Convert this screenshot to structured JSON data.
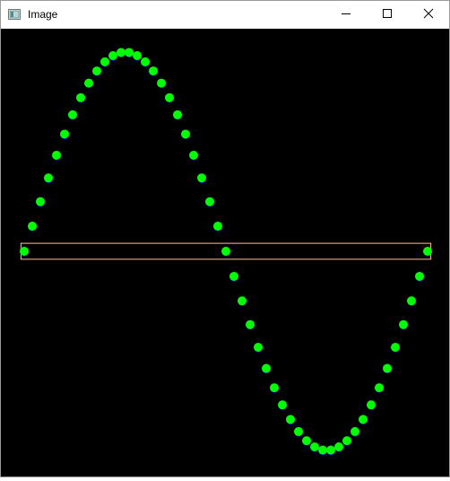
{
  "window": {
    "title": "Image",
    "app_icon": "image-window-icon",
    "controls": [
      "minimize-icon",
      "maximize-icon",
      "close-icon"
    ]
  },
  "canvas": {
    "background": "#000000",
    "point_color": "#00ff00",
    "underlay_color": "#0000ff",
    "box_color": "#ffc0a0"
  },
  "chart_data": {
    "type": "scatter",
    "title": "",
    "xlabel": "",
    "ylabel": "",
    "grid": false,
    "legend": "none",
    "xlim": [
      0,
      50
    ],
    "ylim": [
      -1,
      1
    ],
    "series": [
      {
        "x": [
          0,
          1,
          2,
          3,
          4,
          5,
          6,
          7,
          8,
          9,
          10,
          11,
          12,
          13,
          14,
          15,
          16,
          17,
          18,
          19,
          20,
          21,
          22,
          23,
          24,
          25,
          26,
          27,
          28,
          29,
          30,
          31,
          32,
          33,
          34,
          35,
          36,
          37,
          38,
          39,
          40,
          41,
          42,
          43,
          44,
          45,
          46,
          47,
          48,
          49,
          50
        ],
        "y": [
          0.0,
          0.126,
          0.249,
          0.368,
          0.482,
          0.588,
          0.685,
          0.771,
          0.844,
          0.905,
          0.951,
          0.982,
          0.998,
          0.998,
          0.982,
          0.951,
          0.905,
          0.844,
          0.771,
          0.685,
          0.588,
          0.482,
          0.368,
          0.249,
          0.126,
          0.0,
          -0.126,
          -0.249,
          -0.368,
          -0.482,
          -0.588,
          -0.685,
          -0.771,
          -0.844,
          -0.905,
          -0.951,
          -0.982,
          -0.998,
          -0.998,
          -0.982,
          -0.951,
          -0.905,
          -0.844,
          -0.771,
          -0.685,
          -0.588,
          -0.482,
          -0.368,
          -0.249,
          -0.126,
          0.0
        ]
      }
    ],
    "highlight": {
      "type": "band",
      "y_range": [
        -0.04,
        0.04
      ],
      "x_range": [
        -0.4,
        50.4
      ]
    }
  }
}
